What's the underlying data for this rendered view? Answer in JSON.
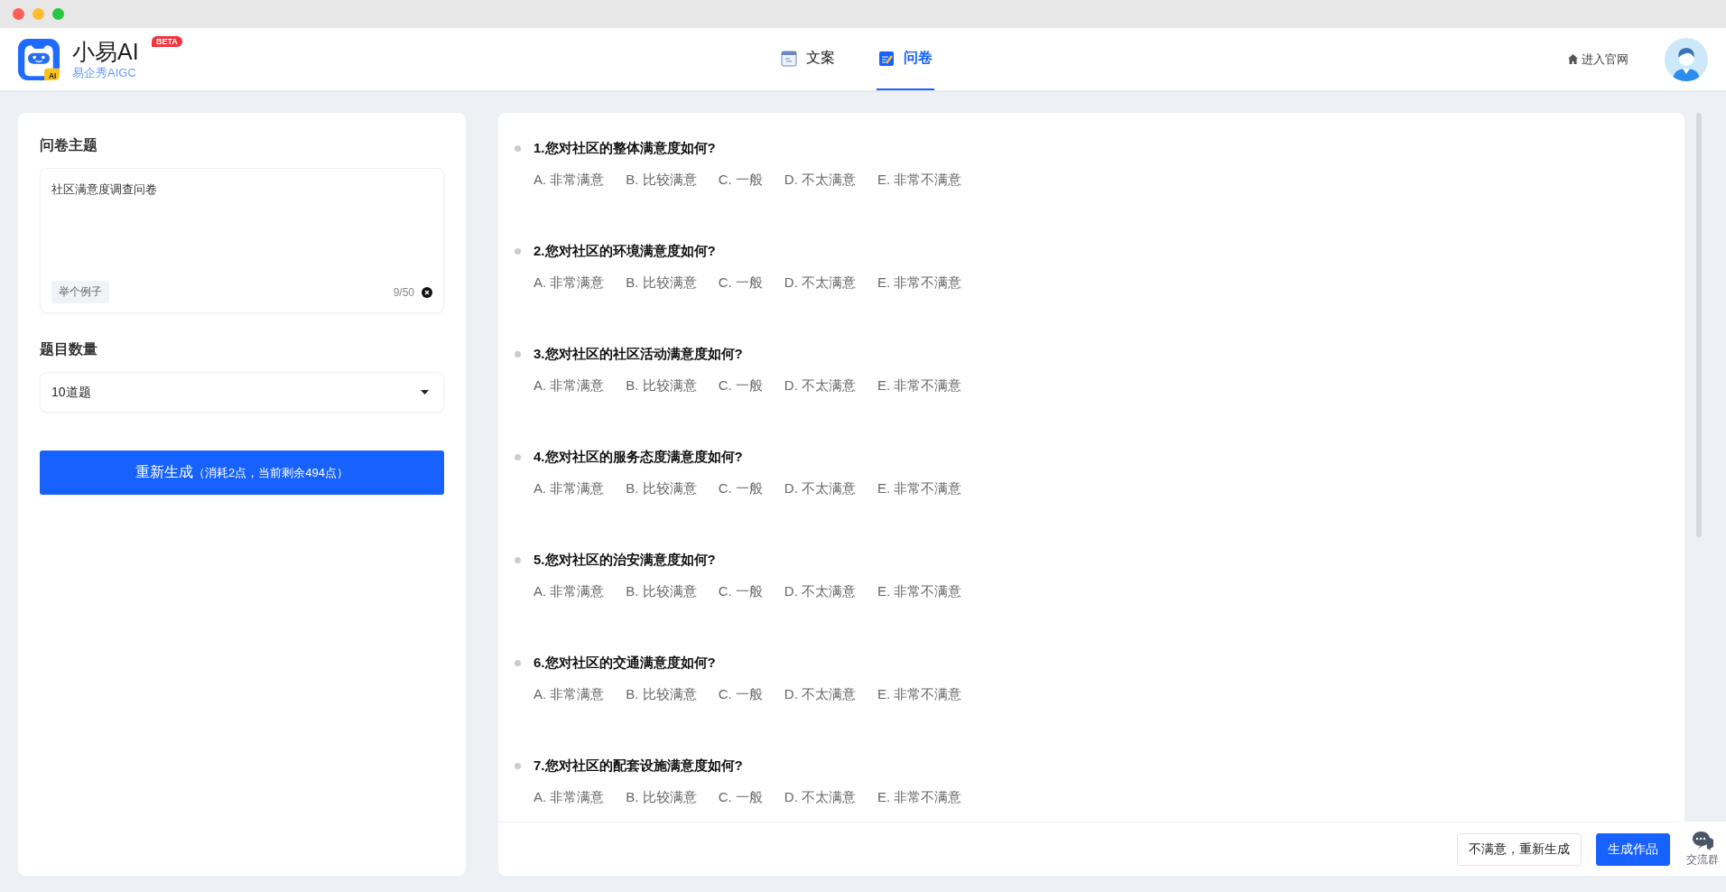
{
  "header": {
    "logo_mark": "AI",
    "app_name": "小易AI",
    "badge": "BETA",
    "subtitle": "易企秀AIGC",
    "tabs": [
      {
        "label": "文案",
        "selected": false,
        "kind": "doc"
      },
      {
        "label": "问卷",
        "selected": true,
        "kind": "survey"
      }
    ],
    "site_link": "进入官网"
  },
  "form": {
    "topic_label": "问卷主题",
    "topic_value": "社区满意度调查问卷",
    "example_chip": "举个例子",
    "counter": "9/50",
    "count_label": "题目数量",
    "count_value": "10道题",
    "regenerate_label": "重新生成",
    "regenerate_note": "（消耗2点，当前剩余494点）"
  },
  "questions": [
    {
      "title": "1.您对社区的整体满意度如何?",
      "options": [
        "A. 非常满意",
        "B. 比较满意",
        "C. 一般",
        "D. 不太满意",
        "E. 非常不满意"
      ]
    },
    {
      "title": "2.您对社区的环境满意度如何?",
      "options": [
        "A. 非常满意",
        "B. 比较满意",
        "C. 一般",
        "D. 不太满意",
        "E. 非常不满意"
      ]
    },
    {
      "title": "3.您对社区的社区活动满意度如何?",
      "options": [
        "A. 非常满意",
        "B. 比较满意",
        "C. 一般",
        "D. 不太满意",
        "E. 非常不满意"
      ]
    },
    {
      "title": "4.您对社区的服务态度满意度如何?",
      "options": [
        "A. 非常满意",
        "B. 比较满意",
        "C. 一般",
        "D. 不太满意",
        "E. 非常不满意"
      ]
    },
    {
      "title": "5.您对社区的治安满意度如何?",
      "options": [
        "A. 非常满意",
        "B. 比较满意",
        "C. 一般",
        "D. 不太满意",
        "E. 非常不满意"
      ]
    },
    {
      "title": "6.您对社区的交通满意度如何?",
      "options": [
        "A. 非常满意",
        "B. 比较满意",
        "C. 一般",
        "D. 不太满意",
        "E. 非常不满意"
      ]
    },
    {
      "title": "7.您对社区的配套设施满意度如何?",
      "options": [
        "A. 非常满意",
        "B. 比较满意",
        "C. 一般",
        "D. 不太满意",
        "E. 非常不满意"
      ]
    }
  ],
  "footer_buttons": [
    {
      "label": "不满意，重新生成",
      "kind": "outline"
    },
    {
      "label": "生成作品",
      "kind": "primary"
    }
  ],
  "chat_widget": {
    "label": "交流群"
  }
}
